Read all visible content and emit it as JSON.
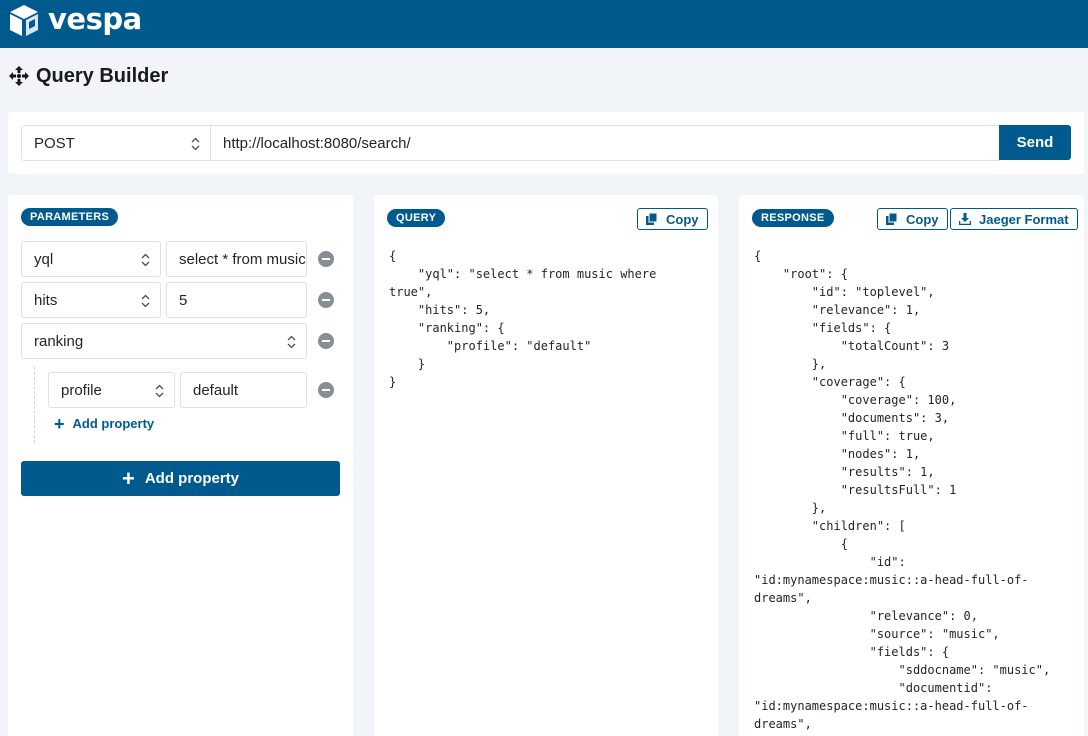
{
  "app": {
    "brand": "vespa"
  },
  "page": {
    "title": "Query Builder"
  },
  "request": {
    "method": "POST",
    "url": "http://localhost:8080/search/",
    "send_label": "Send"
  },
  "parameters": {
    "badge": "PARAMETERS",
    "rows": [
      {
        "key": "yql",
        "value": "select * from music where true"
      },
      {
        "key": "hits",
        "value": "5"
      },
      {
        "key": "ranking"
      }
    ],
    "nested": [
      {
        "key": "profile",
        "value": "default"
      }
    ],
    "add_property_nested": "Add property",
    "add_property": "Add property"
  },
  "query": {
    "badge": "QUERY",
    "copy_label": "Copy",
    "lines": [
      "{",
      "    \"yql\": \"select * from music where",
      "true\",",
      "    \"hits\": 5,",
      "    \"ranking\": {",
      "        \"profile\": \"default\"",
      "    }",
      "}"
    ]
  },
  "response": {
    "badge": "RESPONSE",
    "copy_label": "Copy",
    "jaeger_label": "Jaeger Format",
    "lines": [
      "{",
      "    \"root\": {",
      "        \"id\": \"toplevel\",",
      "        \"relevance\": 1,",
      "        \"fields\": {",
      "            \"totalCount\": 3",
      "        },",
      "        \"coverage\": {",
      "            \"coverage\": 100,",
      "            \"documents\": 3,",
      "            \"full\": true,",
      "            \"nodes\": 1,",
      "            \"results\": 1,",
      "            \"resultsFull\": 1",
      "        },",
      "        \"children\": [",
      "            {",
      "                \"id\":",
      "\"id:mynamespace:music::a-head-full-of-",
      "dreams\",",
      "                \"relevance\": 0,",
      "                \"source\": \"music\",",
      "                \"fields\": {",
      "                    \"sddocname\": \"music\",",
      "                    \"documentid\":",
      "\"id:mynamespace:music::a-head-full-of-",
      "dreams\","
    ]
  },
  "icons": {
    "logo": "vespa-cube-icon",
    "title": "move-arrows-icon",
    "copy": "copy-icon",
    "download": "download-icon",
    "remove": "minus-circle-icon",
    "select": "select-arrows-icon",
    "add": "plus-icon"
  },
  "colors": {
    "brand": "#005a8e",
    "background": "#f1f4f8",
    "remove_icon": "#868e96"
  }
}
